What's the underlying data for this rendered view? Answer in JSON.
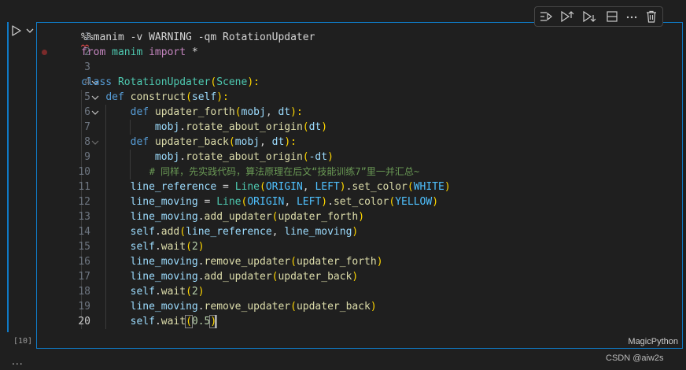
{
  "cell": {
    "execution_count": "[10]",
    "language": "MagicPython",
    "more_label": "...",
    "active_line": "20"
  },
  "toolbar": {
    "items": [
      "execute-above-icon",
      "run-above-icon",
      "run-below-icon",
      "split-cell-icon",
      "more-actions-icon",
      "delete-cell-icon"
    ]
  },
  "code": {
    "line_numbers": [
      "1",
      "2",
      "3",
      "4",
      "5",
      "6",
      "7",
      "8",
      "9",
      "10",
      "11",
      "12",
      "13",
      "14",
      "15",
      "16",
      "17",
      "18",
      "19",
      "20"
    ],
    "line1": {
      "a": "%%manim -v WARNING -qm RotationUpdater"
    },
    "line2": {
      "a": "from",
      "b": " manim ",
      "c": "import",
      "d": " *"
    },
    "line4": {
      "a": "class",
      "b": "RotationUpdater",
      "c": "(",
      "d": "Scene",
      "e": "):"
    },
    "line5": {
      "a": "def",
      "b": "construct",
      "c": "(",
      "d": "self",
      "e": "):"
    },
    "line6": {
      "a": "def",
      "b": "updater_forth",
      "c": "(",
      "d": "mobj",
      "e": ", ",
      "f": "dt",
      "g": "):"
    },
    "line7": {
      "a": "mobj",
      "b": ".",
      "c": "rotate_about_origin",
      "d": "(",
      "e": "dt",
      "f": ")"
    },
    "line8": {
      "a": "def",
      "b": "updater_back",
      "c": "(",
      "d": "mobj",
      "e": ", ",
      "f": "dt",
      "g": "):"
    },
    "line9": {
      "a": "mobj",
      "b": ".",
      "c": "rotate_about_origin",
      "d": "(",
      "e": "-dt",
      "f": ")"
    },
    "line10": {
      "a": "# 同样，先实践代码，算法原理在后文“技能训练7”里一并汇总~"
    },
    "line11": {
      "a": "line_reference",
      "b": " = ",
      "c": "Line",
      "d": "(",
      "e": "ORIGIN",
      "f": ", ",
      "g": "LEFT",
      "h": ")",
      "i": ".",
      "j": "set_color",
      "k": "(",
      "l": "WHITE",
      "m": ")"
    },
    "line12": {
      "a": "line_moving",
      "b": " = ",
      "c": "Line",
      "d": "(",
      "e": "ORIGIN",
      "f": ", ",
      "g": "LEFT",
      "h": ")",
      "i": ".",
      "j": "set_color",
      "k": "(",
      "l": "YELLOW",
      "m": ")"
    },
    "line13": {
      "a": "line_moving",
      "b": ".",
      "c": "add_updater",
      "d": "(",
      "e": "updater_forth",
      "f": ")"
    },
    "line14": {
      "a": "self",
      "b": ".",
      "c": "add",
      "d": "(",
      "e": "line_reference",
      "f": ", ",
      "g": "line_moving",
      "h": ")"
    },
    "line15": {
      "a": "self",
      "b": ".",
      "c": "wait",
      "d": "(",
      "e": "2",
      "f": ")"
    },
    "line16": {
      "a": "line_moving",
      "b": ".",
      "c": "remove_updater",
      "d": "(",
      "e": "updater_forth",
      "f": ")"
    },
    "line17": {
      "a": "line_moving",
      "b": ".",
      "c": "add_updater",
      "d": "(",
      "e": "updater_back",
      "f": ")"
    },
    "line18": {
      "a": "self",
      "b": ".",
      "c": "wait",
      "d": "(",
      "e": "2",
      "f": ")"
    },
    "line19": {
      "a": "line_moving",
      "b": ".",
      "c": "remove_updater",
      "d": "(",
      "e": "updater_back",
      "f": ")"
    },
    "line20": {
      "a": "self",
      "b": ".",
      "c": "wait",
      "d": "(",
      "e": "0.5",
      "f": ")"
    }
  },
  "watermark": "CSDN @aiw2s",
  "colors": {
    "focus_border": "#0f7ac6",
    "background": "#1f1f1f",
    "keyword": "#569cd6",
    "import_keyword": "#c586c0",
    "function": "#dcdcaa",
    "class": "#4ec9b0",
    "variable": "#9cdcfe",
    "constant": "#4fc1ff",
    "number": "#b5cea8",
    "comment": "#6a9955",
    "bracket": "#ffd700"
  }
}
